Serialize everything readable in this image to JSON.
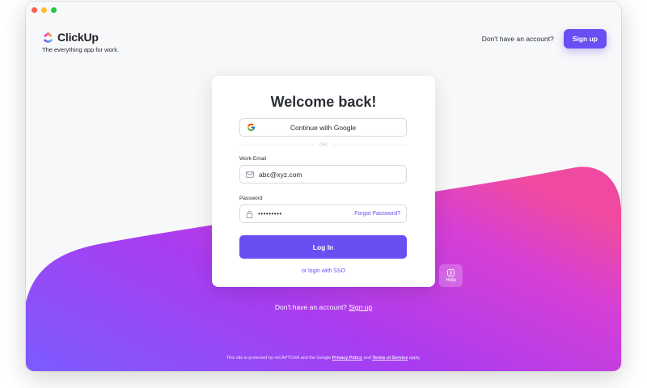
{
  "brand": {
    "name": "ClickUp",
    "tagline": "The everything app for work."
  },
  "header": {
    "question": "Don't have an account?",
    "signup_label": "Sign up"
  },
  "login": {
    "title": "Welcome back!",
    "google_label": "Continue with Google",
    "or_label": "OR",
    "email_label": "Work Email",
    "email_value": "abc@xyz.com",
    "password_label": "Password",
    "password_value": "•••••••••",
    "forgot_label": "Forgot Password?",
    "login_label": "Log In",
    "sso_label": "or login with SSO"
  },
  "help": {
    "label": "Help"
  },
  "footer": {
    "question": "Don't have an account?",
    "signup_link": "Sign up",
    "legal_prefix": "This site is protected by reCAPTCHA and the Google",
    "privacy_label": "Privacy Policy",
    "legal_and": "and",
    "terms_label": "Terms of Service",
    "legal_suffix": "apply."
  },
  "colors": {
    "accent": "#6b4ef2",
    "gradient_start": "#7b5cff",
    "gradient_mid": "#b93cf0",
    "gradient_end": "#f04aa0"
  }
}
